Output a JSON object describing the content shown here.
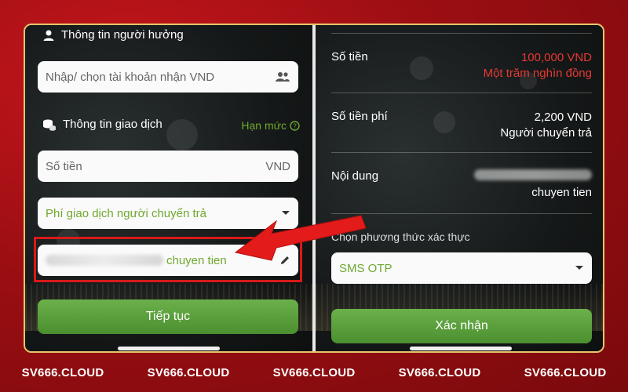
{
  "left": {
    "beneficiary_title": "Thông tin người hưởng",
    "account_placeholder": "Nhập/ chọn tài khoản nhận VND",
    "transaction_title": "Thông tin giao dịch",
    "limit_link": "Hạn mức",
    "amount_placeholder": "Số tiền",
    "amount_currency": "VND",
    "fee_select": "Phí giao dịch người chuyển trả",
    "content_value": "chuyen tien",
    "continue_button": "Tiếp tục"
  },
  "right": {
    "amount_label": "Số tiền",
    "amount_value": "100,000 VND",
    "amount_words": "Một trăm nghìn đồng",
    "fee_label": "Số tiền phí",
    "fee_value": "2,200 VND",
    "fee_payer": "Người chuyển trả",
    "content_label": "Nội dung",
    "content_value": "chuyen tien",
    "auth_label": "Chọn phương thức xác thực",
    "auth_select": "SMS OTP",
    "confirm_button": "Xác nhận"
  },
  "footer": {
    "watermarks": [
      "SV666.CLOUD",
      "SV666.CLOUD",
      "SV666.CLOUD",
      "SV666.CLOUD",
      "SV666.CLOUD"
    ]
  },
  "colors": {
    "accent_green": "#6fa82f",
    "alert_red": "#e53935",
    "highlight_red": "#d91a1a",
    "brand_red": "#b01217",
    "frame_gold": "#e9c46a"
  },
  "icons": [
    "user-icon",
    "contacts-icon",
    "coins-icon",
    "help-circle-icon",
    "chevron-down-icon",
    "pencil-icon",
    "arrow-pointer"
  ]
}
